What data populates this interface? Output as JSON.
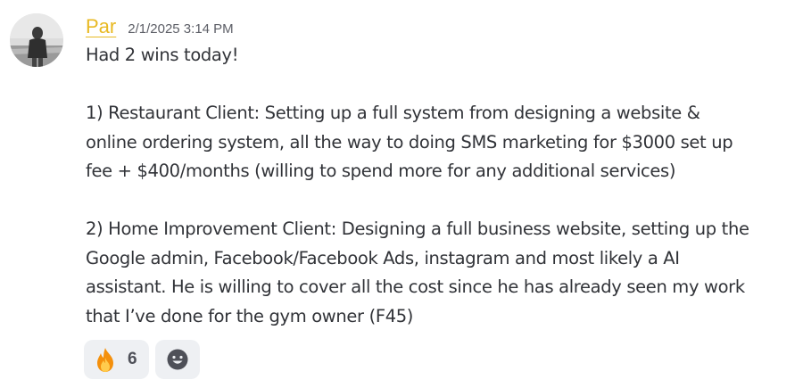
{
  "message": {
    "author": "Par",
    "timestamp": "2/1/2025 3:14 PM",
    "avatar_icon": "user-avatar-photo",
    "lines": {
      "l1": "Had 2 wins today!",
      "l2": "1) Restaurant Client: Setting up a full system from designing a website &",
      "l3": "online ordering system, all the way to doing SMS marketing for $3000 set up",
      "l4": "fee + $400/months (willing to spend more for any additional services)",
      "l5": "2) Home Improvement Client: Designing a full business website, setting up the",
      "l6": "Google admin, Facebook/Facebook Ads, instagram and most likely a AI",
      "l7": "assistant. He is willing to cover all the cost since he has already seen my work",
      "l8": "that I’ve done for the gym owner (F45)"
    }
  },
  "reactions": [
    {
      "emoji": "fire-emoji",
      "count": "6"
    },
    {
      "emoji": "add-reaction-icon"
    }
  ],
  "colors": {
    "username": "#e8b923",
    "text": "#313338",
    "timestamp": "#5c5e66",
    "reaction_bg": "#eef0f3"
  }
}
